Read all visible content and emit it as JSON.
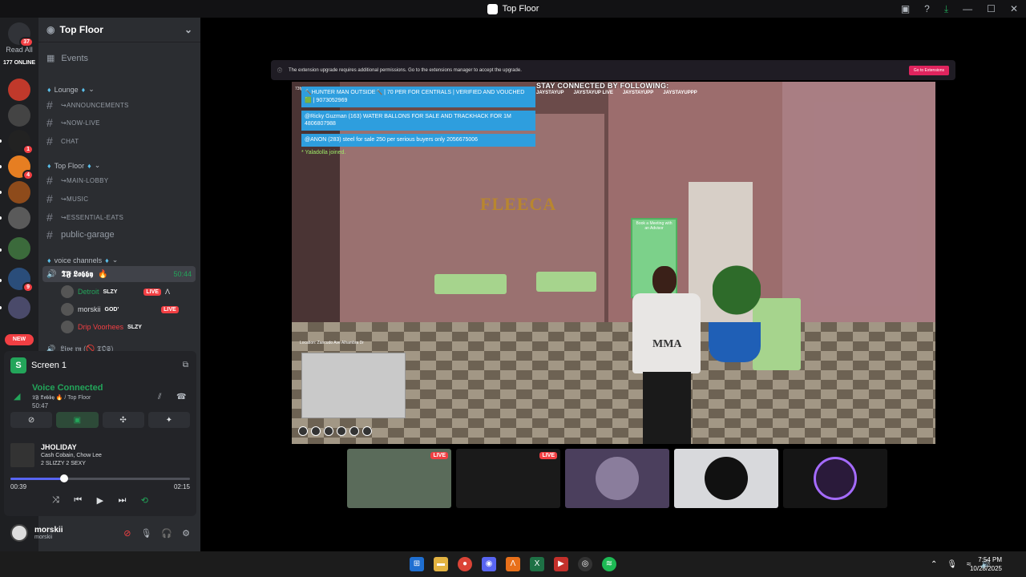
{
  "window": {
    "title": "Top Floor"
  },
  "servers": {
    "read_all": "Read All",
    "online": "177 ONLINE",
    "new_label": "NEW",
    "badges": [
      "37",
      "1",
      "4",
      "9"
    ]
  },
  "channel_list": {
    "server_name": "Top Floor",
    "events_label": "Events",
    "cat_lounge": "Lounge",
    "channels_lounge": [
      "↪ANNOUNCEMENTS",
      "↪NOW-LIVE",
      "CHAT"
    ],
    "cat_topfloor": "Top Floor",
    "channels_topfloor": [
      "↪MAIN-LOBBY",
      "↪MUSIC",
      "↪ESSENTIAL-EATS",
      "public-garage"
    ],
    "cat_voice": "voice channels",
    "voice_channel": {
      "name": "𝕿𝕱 𝕷𝖔𝖇𝖇𝖞",
      "time": "50:44"
    },
    "voice_users": [
      {
        "name": "Detroit",
        "tag": "SLZY",
        "live": "LIVE",
        "color": "#23a55a"
      },
      {
        "name": "morskii",
        "tag": "GOD'",
        "live": "LIVE",
        "color": "#dbdee1"
      },
      {
        "name": "Drip Voorhees",
        "tag": "SLZY",
        "color": "#f23f43"
      }
    ],
    "partial_channel": "𝕷𝖎𝖛𝖊 𝖗𝖓 (🚫 𝕿𝕺𝕾)"
  },
  "panel": {
    "screen_label": "Screen 1",
    "voice_status": "Voice Connected",
    "voice_location": "𝕿𝕱 𝕷𝖔𝖇𝖇𝖞 🔥 / Top Floor",
    "elapsed": "50:47",
    "song": {
      "title": "JHOLIDAY",
      "artist": "Cash Cobain, Chow Lee",
      "album": "2 SLIZZY 2 SEXY",
      "current": "00:39",
      "total": "02:15",
      "progress": 0.3
    }
  },
  "user": {
    "name": "morskii",
    "status": "morskii"
  },
  "stream": {
    "notice": "The extension upgrade requires additional permissions. Go to the extensions manager to accept the upgrade.",
    "notice_button": "Go to Extensions",
    "fps": "73fps",
    "chat": [
      "🔨HUNTER MAN OUTSIDE🔨 | 70 PER FOR CENTRALS | VERIFIED AND VOUCHED 🟩 | 9073052969",
      "@Ricky Guzman (163) WATER BALLONS FOR SALE AND TRACKHACK FOR 1M 4806807988",
      "@ANON (283) steel for sale 250 per serious buyers only 2056675006"
    ],
    "joined": "* Yaladolla joined.",
    "stay_connected": "STAY CONNECTED BY FOLLOWING:",
    "socials": [
      "JAYSTAYUP",
      "JAYSTAYUP LIVE",
      "JAYSTAYUPP",
      "JAYSTAYUPPP"
    ],
    "sign": "FLEECA",
    "shirt": "MMA",
    "poster": "Book a Meeting with an Advisor",
    "location": "Location: Zancudo Ave Alhambra Dr",
    "thumbs_live": [
      "LIVE",
      "LIVE"
    ]
  },
  "taskbar": {
    "time": "7:54 PM",
    "date": "10/28/2025"
  }
}
